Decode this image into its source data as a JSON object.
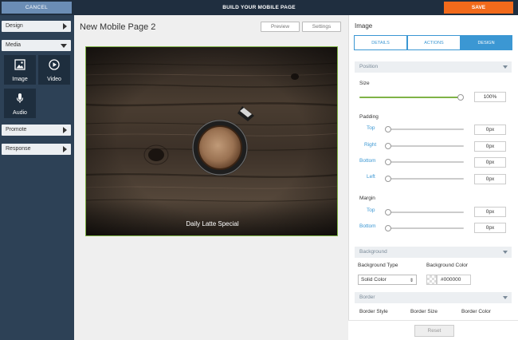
{
  "topbar": {
    "cancel_label": "CANCEL",
    "title": "BUILD YOUR MOBILE PAGE",
    "save_label": "SAVE"
  },
  "sidebar": {
    "design_label": "Design",
    "media_label": "Media",
    "media_tiles": [
      {
        "label": "Image",
        "icon": "image-icon"
      },
      {
        "label": "Video",
        "icon": "play-icon"
      },
      {
        "label": "Audio",
        "icon": "microphone-icon"
      }
    ],
    "promote_label": "Promote",
    "response_label": "Response"
  },
  "canvas": {
    "page_title": "New Mobile Page 2",
    "preview_label": "Preview",
    "settings_label": "Settings",
    "caption": "Daily Latte Special"
  },
  "panel": {
    "title": "Image",
    "tabs": [
      "DETAILS",
      "ACTIONS",
      "DESIGN"
    ],
    "active_tab": "DESIGN",
    "position": {
      "header": "Position",
      "size_label": "Size",
      "size_value": "100%",
      "size_fraction": 1.0,
      "padding_label": "Padding",
      "padding": [
        {
          "label": "Top",
          "value": "0px"
        },
        {
          "label": "Right",
          "value": "0px"
        },
        {
          "label": "Bottom",
          "value": "0px"
        },
        {
          "label": "Left",
          "value": "0px"
        }
      ],
      "margin_label": "Margin",
      "margin": [
        {
          "label": "Top",
          "value": "0px"
        },
        {
          "label": "Bottom",
          "value": "0px"
        }
      ]
    },
    "background": {
      "header": "Background",
      "type_label": "Background Type",
      "type_value": "Solid Color",
      "color_label": "Background Color",
      "color_value": "#000000"
    },
    "border": {
      "header": "Border",
      "style_label": "Border Style",
      "size_label": "Border Size",
      "color_label": "Border Color"
    },
    "reset_label": "Reset"
  },
  "colors": {
    "topbar": "#1f2e3f",
    "sidebar": "#2d4156",
    "save": "#f26a1b",
    "cancel": "#6b8db5",
    "accent": "#3b97d3",
    "slider_fill": "#7fb346"
  }
}
